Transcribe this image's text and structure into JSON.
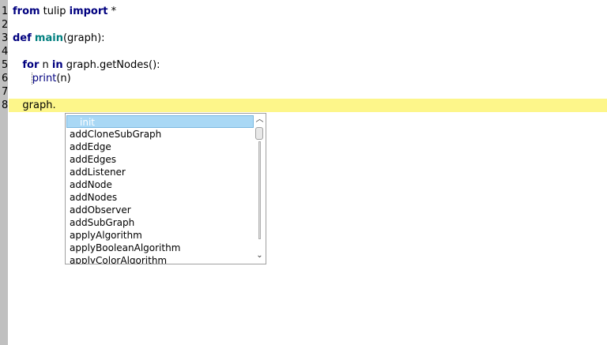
{
  "editor": {
    "lines": [
      {
        "num": "1",
        "tokens": [
          {
            "t": "from",
            "c": "kw"
          },
          {
            "t": " tulip ",
            "c": ""
          },
          {
            "t": "import",
            "c": "kw"
          },
          {
            "t": " *",
            "c": ""
          }
        ]
      },
      {
        "num": "2",
        "tokens": []
      },
      {
        "num": "3",
        "tokens": [
          {
            "t": "def",
            "c": "kw"
          },
          {
            "t": " ",
            "c": ""
          },
          {
            "t": "main",
            "c": "fn"
          },
          {
            "t": "(graph):",
            "c": ""
          }
        ]
      },
      {
        "num": "4",
        "tokens": []
      },
      {
        "num": "5",
        "tokens": [
          {
            "t": "   ",
            "c": ""
          },
          {
            "t": "for",
            "c": "kw"
          },
          {
            "t": " n ",
            "c": ""
          },
          {
            "t": "in",
            "c": "kw"
          },
          {
            "t": " graph.getNodes():",
            "c": ""
          }
        ]
      },
      {
        "num": "6",
        "tokens": [
          {
            "t": "      ",
            "c": ""
          },
          {
            "t": "print",
            "c": "bi"
          },
          {
            "t": "(n)",
            "c": ""
          }
        ]
      },
      {
        "num": "7",
        "tokens": []
      },
      {
        "num": "8",
        "tokens": [
          {
            "t": "   graph.",
            "c": ""
          }
        ]
      }
    ]
  },
  "autocomplete": {
    "selected": "__init__",
    "items": [
      "__init__",
      "addCloneSubGraph",
      "addEdge",
      "addEdges",
      "addListener",
      "addNode",
      "addNodes",
      "addObserver",
      "addSubGraph",
      "applyAlgorithm",
      "applyBooleanAlgorithm",
      "applyColorAlgorithm"
    ],
    "scroll_up_icon": "chevron-up-icon",
    "scroll_down_icon": "chevron-down-icon"
  }
}
